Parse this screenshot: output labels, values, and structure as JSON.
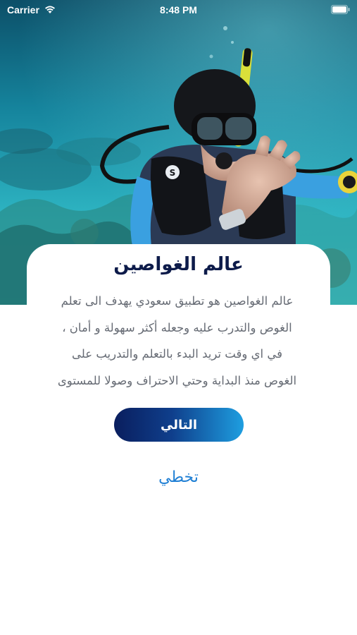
{
  "status_bar": {
    "carrier": "Carrier",
    "time": "8:48 PM"
  },
  "hero": {
    "image": "scuba-diver-underwater-photo"
  },
  "onboarding": {
    "title": "عالم الغواصين",
    "description_lines": [
      "عالم الغواصين هو تطبيق سعودي يهدف الى تعلم",
      "الغوص والتدرب عليه وجعله أكثر سهولة و أمان ،",
      "في اي وقت تريد البدء بالتعلم والتدريب على",
      "الغوص منذ البداية وحتي الاحتراف وصولا للمستوى"
    ],
    "next_label": "التالي",
    "skip_label": "تخطي"
  },
  "colors": {
    "title": "#0d1b4a",
    "body_text": "#666b74",
    "button_start": "#0a1e5e",
    "button_end": "#1e9ee0",
    "skip_link": "#1f7fd4"
  }
}
